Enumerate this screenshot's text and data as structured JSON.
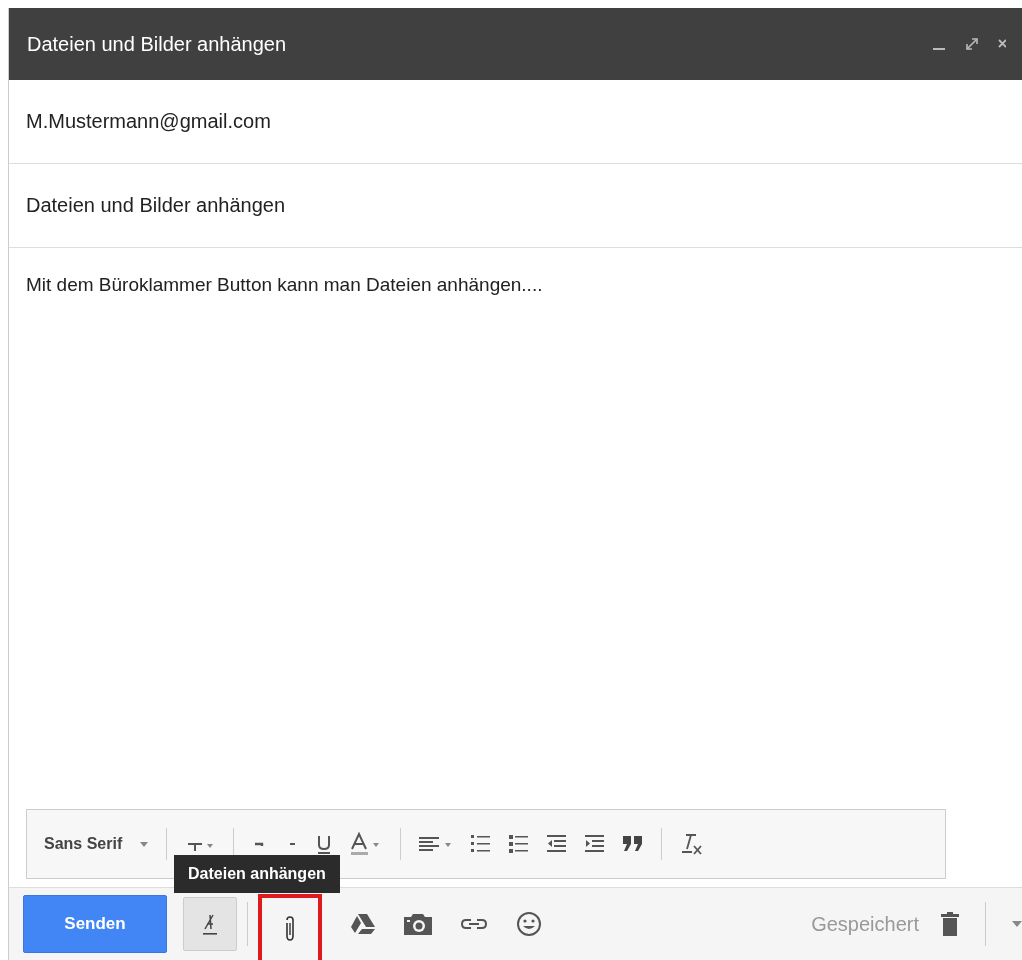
{
  "window": {
    "title": "Dateien und Bilder anhängen"
  },
  "to": {
    "value": "M.Mustermann@gmail.com"
  },
  "subject": {
    "value": "Dateien und Bilder anhängen"
  },
  "body": {
    "value": "Mit dem Büroklammer Button kann man Dateien anhängen...."
  },
  "format_bar": {
    "font": "Sans Serif"
  },
  "tooltip": {
    "text": "Dateien anhängen"
  },
  "toolbar": {
    "send": "Senden",
    "attach_highlighted": true,
    "status": "Gespeichert"
  }
}
